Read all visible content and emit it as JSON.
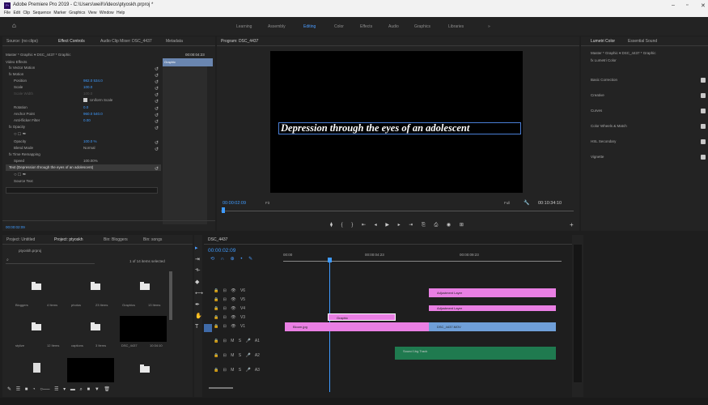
{
  "window": {
    "title": "Adobe Premiere Pro 2019 - C:\\Users\\weil\\Videos\\ptyoskh.prproj *",
    "menu": "File  Edit  Clip  Sequence  Marker  Graphics  View  Window  Help"
  },
  "workspaces": [
    "Learning",
    "Assembly",
    "Editing",
    "Color",
    "Effects",
    "Audio",
    "Graphics",
    "Libraries"
  ],
  "source_tabs": {
    "source": "Source: (no clips)",
    "effect_controls": "Effect Controls",
    "audio_clip_mixer": "Audio Clip Mixer: DSC_4437",
    "metadata": "Metadata"
  },
  "effect_controls": {
    "header": "Master * Graphic  ▾  DSC_4437 * Graphic",
    "timecode": "00:00:04:23",
    "video_effects": "Video Effects",
    "graphic_bar": "Graphic",
    "rows": [
      {
        "label": "fx  Vector Motion",
        "value": ""
      },
      {
        "label": "fx  Motion",
        "value": ""
      },
      {
        "label": "Position",
        "value": "982.0  534.0"
      },
      {
        "label": "Scale",
        "value": "100.0"
      },
      {
        "label": "Scale Width",
        "value": "100.0"
      },
      {
        "label": "",
        "value": "Uniform Scale"
      },
      {
        "label": "Rotation",
        "value": "0.0"
      },
      {
        "label": "Anchor Point",
        "value": "960.0  540.0"
      },
      {
        "label": "Anti-flicker Filter",
        "value": "0.00"
      },
      {
        "label": "fx  Opacity",
        "value": ""
      },
      {
        "label": "",
        "value": ""
      },
      {
        "label": "Opacity",
        "value": "100.0 %"
      },
      {
        "label": "Blend Mode",
        "value": "Normal"
      },
      {
        "label": "fx  Time Remapping",
        "value": ""
      },
      {
        "label": "Speed",
        "value": "100.00%"
      },
      {
        "label": "Text (Depression through the eyes of an adolescent)",
        "value": ""
      },
      {
        "label": "",
        "value": ""
      },
      {
        "label": "Source Text",
        "value": ""
      }
    ],
    "bottom_timecode": "00:00:02:09"
  },
  "program": {
    "tab": "Program: DSC_4437",
    "caption": "Depression through the eyes of an adolescent",
    "timecode": "00:00:02:09",
    "fit": "Fit",
    "quality": "Full",
    "duration": "00:10:34:10"
  },
  "lumetri": {
    "tab1": "Lumetri Color",
    "tab2": "Essential Sound",
    "header": "Master * Graphic  ▾  DSC_4437 * Graphic",
    "fx": "fx  Lumetri Color",
    "sections": [
      "Basic Correction",
      "Creative",
      "Curves",
      "Color Wheels & Match",
      "HSL Secondary",
      "Vignette"
    ]
  },
  "project": {
    "tabs": [
      "Project: Untitled",
      "Project: ptyoskh",
      "Bin: Bloggers",
      "Bin: songs"
    ],
    "file": "ptyoskh.prproj",
    "selected": "1 of 14 items selected",
    "items": [
      {
        "name": "Bloggers",
        "meta": "4 Items"
      },
      {
        "name": "photos",
        "meta": "23 Items"
      },
      {
        "name": "Graphics",
        "meta": "13 Items"
      },
      {
        "name": "stylize",
        "meta": "12 Items"
      },
      {
        "name": "captions",
        "meta": "3 Items"
      },
      {
        "name": "DSC_4437",
        "meta": "10:34:10"
      }
    ]
  },
  "timeline": {
    "tab": "DSC_4437",
    "timecode": "00:00:02:09",
    "ruler": [
      "00:00",
      "00:00:04:23",
      "00:00:09:23"
    ],
    "tracks": [
      "V6",
      "V5",
      "V4",
      "V3",
      "V2",
      "V1",
      "A1",
      "A2",
      "A3"
    ],
    "clips": {
      "adjustment1": "Adjustment Layer",
      "adjustment2": "Adjustment Layer",
      "graphic": "Graphic",
      "bloom": "Bloom.jpg",
      "dsc": "DSC_4437.MOV",
      "audio": "Sound 1bg Track"
    }
  }
}
